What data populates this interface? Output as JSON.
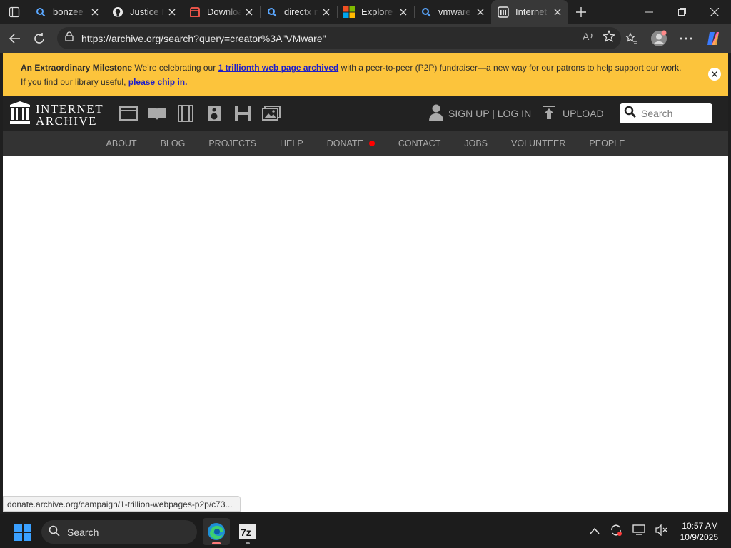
{
  "browser": {
    "tabs": [
      {
        "title": "bonzee",
        "icon": "search-icon",
        "active": false
      },
      {
        "title": "Justice M",
        "icon": "github-icon",
        "active": false
      },
      {
        "title": "Downloa",
        "icon": "red-document-icon",
        "active": false
      },
      {
        "title": "directx n",
        "icon": "search-icon",
        "active": false
      },
      {
        "title": "Explore t",
        "icon": "microsoft-logo-icon",
        "active": false
      },
      {
        "title": "vmware",
        "icon": "search-icon",
        "active": false
      },
      {
        "title": "Internet",
        "icon": "archive-columns-icon",
        "active": true
      }
    ],
    "url": "https://archive.org/search?query=creator%3A\"VMware\"",
    "status_url": "donate.archive.org/campaign/1-trillion-webpages-p2p/c73..."
  },
  "banner": {
    "heading": "An Extraordinary Milestone",
    "text1": " We’re celebrating our ",
    "link1": "1 trillionth web page archived",
    "text2": " with a peer-to-peer (P2P) fundraiser—a new way for our patrons to help support our work. If you find our library useful, ",
    "link2": "please chip in."
  },
  "ia_header": {
    "logo_line1": "INTERNET",
    "logo_line2": "ARCHIVE",
    "media_icons": [
      "web-icon",
      "texts-icon",
      "video-icon",
      "audio-icon",
      "software-icon",
      "images-icon"
    ],
    "auth": "SIGN UP | LOG IN",
    "upload": "UPLOAD",
    "search_placeholder": "Search"
  },
  "ia_nav": {
    "items": [
      "ABOUT",
      "BLOG",
      "PROJECTS",
      "HELP",
      "DONATE",
      "CONTACT",
      "JOBS",
      "VOLUNTEER",
      "PEOPLE"
    ],
    "donate_dot_color": "#ff0000"
  },
  "taskbar": {
    "search_label": "Search",
    "time": "10:57 AM",
    "date": "10/9/2025"
  },
  "colors": {
    "banner_bg": "#fcc43c",
    "ia_header_bg": "#222222",
    "ia_nav_bg": "#333333",
    "link": "#1f1fc8"
  }
}
